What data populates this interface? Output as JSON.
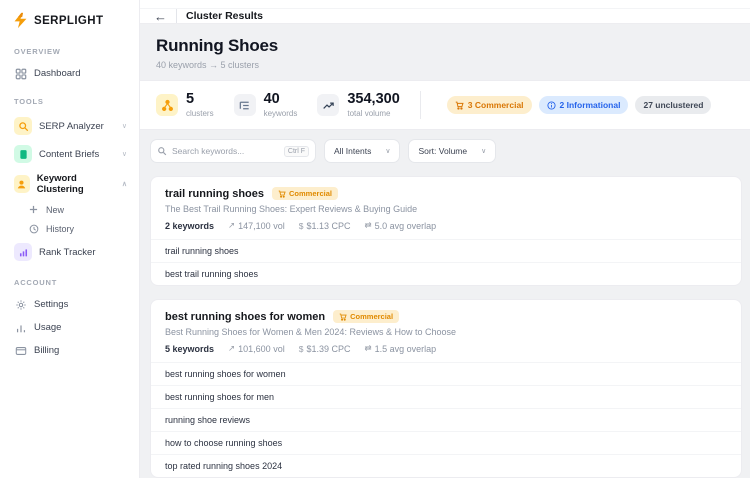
{
  "colors": {
    "accent_orange": "#f59e0b",
    "commercial_text": "#d97706",
    "commercial_bg": "#fdeecd",
    "informational_text": "#2563eb",
    "informational_bg": "#dbeafe",
    "neutral_badge_bg": "#e9ebee",
    "content_bg": "#f0f1f3",
    "green": "#10b981",
    "purple": "#8b5cf6"
  },
  "app": {
    "name": "SERPLIGHT",
    "logo_icon": "lightning-bolt-icon"
  },
  "sidebar": {
    "sections": [
      {
        "label": "OVERVIEW",
        "items": [
          {
            "label": "Dashboard",
            "icon": "dashboard-grid-icon"
          }
        ]
      },
      {
        "label": "TOOLS",
        "items": [
          {
            "label": "SERP Analyzer",
            "icon": "magnifier-icon",
            "chevron": "down"
          },
          {
            "label": "Content Briefs",
            "icon": "document-icon",
            "chevron": "down"
          },
          {
            "label": "Keyword Clustering",
            "icon": "user-cluster-icon",
            "chevron": "up",
            "active": true,
            "children": [
              {
                "label": "New",
                "icon": "plus-icon"
              },
              {
                "label": "History",
                "icon": "clock-icon"
              }
            ]
          },
          {
            "label": "Rank Tracker",
            "icon": "bar-chart-icon"
          }
        ]
      },
      {
        "label": "ACCOUNT",
        "items": [
          {
            "label": "Settings",
            "icon": "gear-icon"
          },
          {
            "label": "Usage",
            "icon": "usage-bars-icon"
          },
          {
            "label": "Billing",
            "icon": "credit-card-icon"
          }
        ]
      }
    ]
  },
  "header": {
    "back": "←",
    "title": "Cluster Results"
  },
  "page": {
    "title": "Running Shoes",
    "subtitle": "40 keywords → 5 clusters"
  },
  "stats": {
    "items": [
      {
        "value": "5",
        "label": "clusters",
        "icon": "network-cluster-icon"
      },
      {
        "value": "40",
        "label": "keywords",
        "icon": "list-tree-icon"
      },
      {
        "value": "354,300",
        "label": "total volume",
        "icon": "trending-up-icon"
      }
    ],
    "badges": [
      {
        "label": "3 Commercial",
        "type": "commercial",
        "icon": "cart-icon"
      },
      {
        "label": "2 Informational",
        "type": "informational",
        "icon": "info-circle-icon"
      },
      {
        "label": "27 unclustered",
        "type": "neutral"
      }
    ]
  },
  "filters": {
    "search_placeholder": "Search keywords...",
    "shortcut": "Ctrl F",
    "intent_label": "All Intents",
    "sort_label": "Sort: Volume"
  },
  "clusters": [
    {
      "name": "trail running shoes",
      "intent_label": "Commercial",
      "suggested_title": "The Best Trail Running Shoes: Expert Reviews & Buying Guide",
      "keywords_count": "2 keywords",
      "volume_icon": "↗",
      "volume": "147,100 vol",
      "cpc_icon": "$",
      "cpc": "$1.13 CPC",
      "overlap_icon": "⇄",
      "overlap": "5.0 avg overlap",
      "keywords": [
        "trail running shoes",
        "best trail running shoes"
      ]
    },
    {
      "name": "best running shoes for women",
      "intent_label": "Commercial",
      "suggested_title": "Best Running Shoes for Women & Men 2024: Reviews & How to Choose",
      "keywords_count": "5 keywords",
      "volume_icon": "↗",
      "volume": "101,600 vol",
      "cpc_icon": "$",
      "cpc": "$1.39 CPC",
      "overlap_icon": "⇄",
      "overlap": "1.5 avg overlap",
      "keywords": [
        "best running shoes for women",
        "best running shoes for men",
        "running shoe reviews",
        "how to choose running shoes",
        "top rated running shoes 2024"
      ]
    }
  ]
}
